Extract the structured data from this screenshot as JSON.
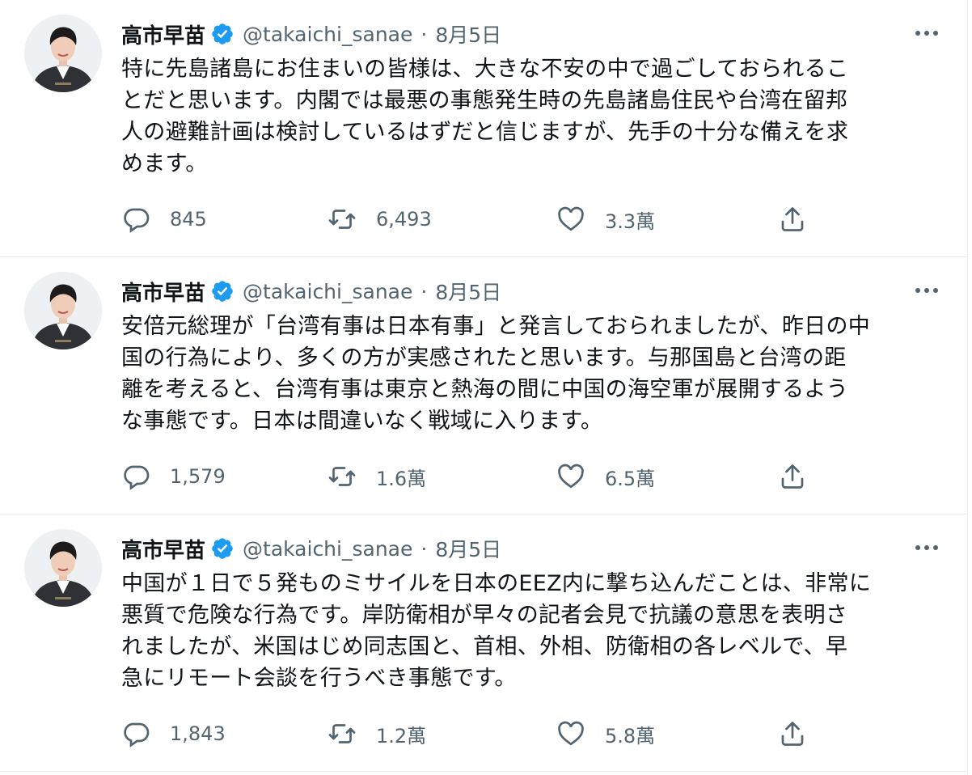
{
  "tweets": [
    {
      "author": {
        "name": "高市早苗",
        "handle": "@takaichi_sanae"
      },
      "separator": "·",
      "date": "8月5日",
      "text": "特に先島諸島にお住まいの皆様は、大きな不安の中で過ごしておられるこ\nとだと思います。内閣では最悪の事態発生時の先島諸島住民や台湾在留邦\n人の避難計画は検討しているはずだと信じますが、先手の十分な備えを求\nめます。",
      "replies": "845",
      "retweets": "6,493",
      "likes": "3.3萬"
    },
    {
      "author": {
        "name": "高市早苗",
        "handle": "@takaichi_sanae"
      },
      "separator": "·",
      "date": "8月5日",
      "text": "安倍元総理が「台湾有事は日本有事」と発言しておられましたが、昨日の中\n国の行為により、多くの方が実感されたと思います。与那国島と台湾の距\n離を考えると、台湾有事は東京と熱海の間に中国の海空軍が展開するよう\nな事態です。日本は間違いなく戦域に入ります。",
      "replies": "1,579",
      "retweets": "1.6萬",
      "likes": "6.5萬"
    },
    {
      "author": {
        "name": "高市早苗",
        "handle": "@takaichi_sanae"
      },
      "separator": "·",
      "date": "8月5日",
      "text": "中国が１日で５発ものミサイルを日本のEEZ内に撃ち込んだことは、非常に\n悪質で危険な行為です。岸防衛相が早々の記者会見で抗議の意思を表明さ\nれましたが、米国はじめ同志国と、首相、外相、防衛相の各レベルで、早\n急にリモート会談を行うべき事態です。",
      "replies": "1,843",
      "retweets": "1.2萬",
      "likes": "5.8萬"
    }
  ],
  "icons": {
    "verified": "verified-badge-icon",
    "more": "more-options-icon",
    "reply": "reply-icon",
    "retweet": "retweet-icon",
    "like": "like-icon",
    "share": "share-icon"
  },
  "colors": {
    "verified": "#1d9bf0",
    "secondary_text": "#536471",
    "primary_text": "#0f1419",
    "divider": "#e6ecf0"
  }
}
